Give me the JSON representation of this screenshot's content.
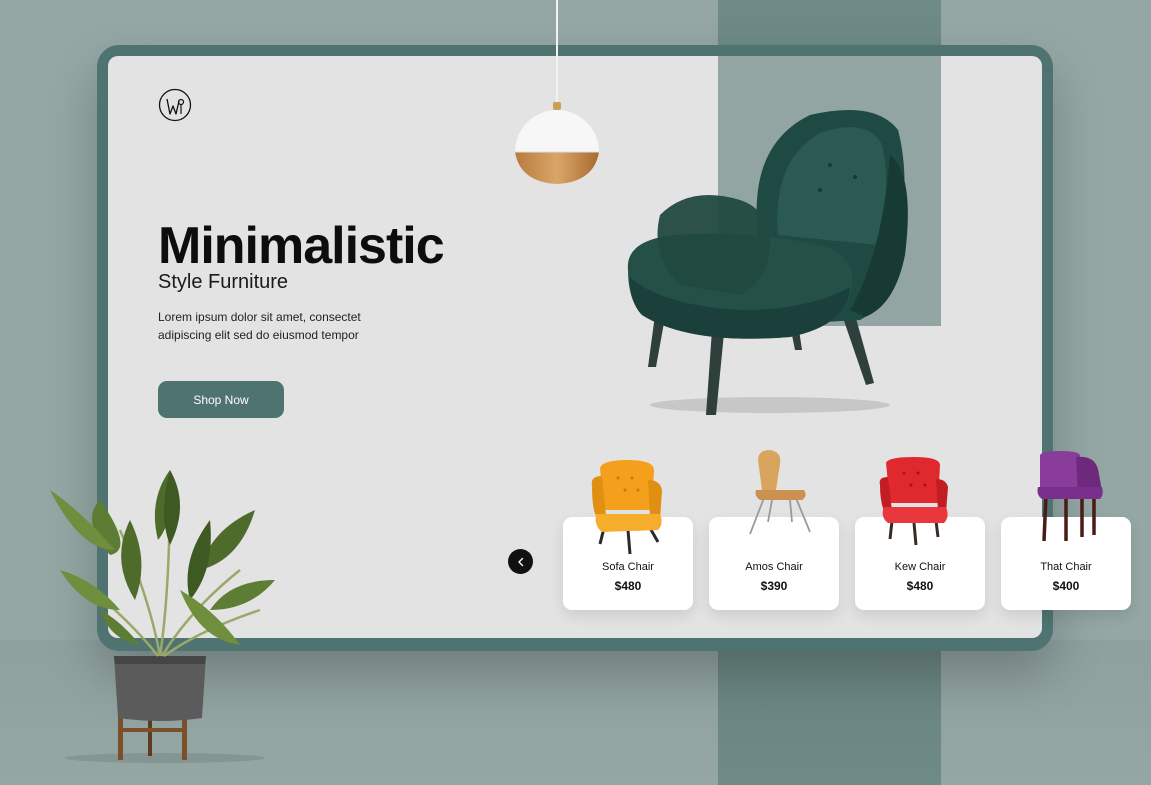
{
  "hero": {
    "title": "Minimalistic",
    "subtitle": "Style Furniture",
    "description": "Lorem ipsum dolor sit amet, consectet adipiscing elit sed do eiusmod tempor",
    "cta_label": "Shop Now"
  },
  "carousel": {
    "prev_icon": "chevron-left-icon",
    "products": [
      {
        "name": "Sofa Chair",
        "price": "$480",
        "color": "#f4a01c"
      },
      {
        "name": "Amos Chair",
        "price": "$390",
        "color": "#d9a55e"
      },
      {
        "name": "Kew Chair",
        "price": "$480",
        "color": "#e0292f"
      },
      {
        "name": "That Chair",
        "price": "$400",
        "color": "#7a2f8c"
      }
    ]
  },
  "colors": {
    "accent": "#4f7370",
    "background": "#94a7a5",
    "screen": "#e3e3e3"
  }
}
